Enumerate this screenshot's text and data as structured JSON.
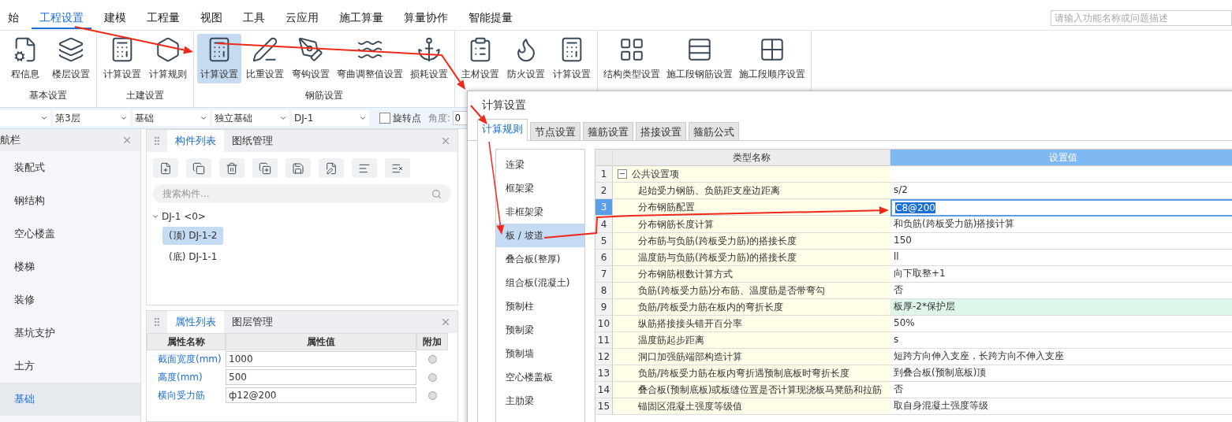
{
  "menu_tabs": [
    {
      "label": "始",
      "selected": false
    },
    {
      "label": "工程设置",
      "selected": true
    },
    {
      "label": "建模",
      "selected": false
    },
    {
      "label": "工程量",
      "selected": false
    },
    {
      "label": "视图",
      "selected": false
    },
    {
      "label": "工具",
      "selected": false
    },
    {
      "label": "云应用",
      "selected": false
    },
    {
      "label": "施工算量",
      "selected": false
    },
    {
      "label": "算量协作",
      "selected": false
    },
    {
      "label": "智能提量",
      "selected": false
    }
  ],
  "search": {
    "placeholder": "请输入功能名称或问题描述"
  },
  "ribbon_groups": [
    {
      "label": "基本设置",
      "buttons": [
        {
          "label": "程信息",
          "selected": false
        },
        {
          "label": "楼层设置",
          "selected": false
        }
      ]
    },
    {
      "label": "土建设置",
      "buttons": [
        {
          "label": "计算设置",
          "selected": false
        },
        {
          "label": "计算规则",
          "selected": false
        }
      ]
    },
    {
      "label": "钢筋设置",
      "buttons": [
        {
          "label": "计算设置",
          "selected": true
        },
        {
          "label": "比重设置",
          "selected": false
        },
        {
          "label": "弯钩设置",
          "selected": false
        },
        {
          "label": "弯曲调整值设置",
          "selected": false
        },
        {
          "label": "损耗设置",
          "selected": false
        }
      ]
    },
    {
      "buttons": [
        {
          "label": "主材设置",
          "selected": false
        },
        {
          "label": "防火设置",
          "selected": false
        },
        {
          "label": "计算设置",
          "selected": false
        }
      ]
    },
    {
      "buttons": [
        {
          "label": "结构类型设置",
          "selected": false
        },
        {
          "label": "施工段钢筋设置",
          "selected": false
        },
        {
          "label": "施工段顺序设置",
          "selected": false
        }
      ]
    }
  ],
  "toolbar": {
    "selects": [
      {
        "value": "第3层"
      },
      {
        "value": "基础"
      },
      {
        "value": "独立基础"
      },
      {
        "value": "DJ-1"
      }
    ],
    "checkbox": {
      "label": "旋转点",
      "checked": false
    },
    "angle": {
      "label": "角度:",
      "value": "0"
    }
  },
  "nav": {
    "title": "航栏",
    "items": [
      {
        "label": "装配式",
        "selected": false
      },
      {
        "label": "钢结构",
        "selected": false
      },
      {
        "label": "空心楼盖",
        "selected": false
      },
      {
        "label": "楼梯",
        "selected": false
      },
      {
        "label": "装修",
        "selected": false
      },
      {
        "label": "基坑支护",
        "selected": false
      },
      {
        "label": "土方",
        "selected": false
      },
      {
        "label": "基础",
        "selected": true
      }
    ]
  },
  "component_panel": {
    "tabs": [
      {
        "label": "构件列表",
        "selected": true
      },
      {
        "label": "图纸管理",
        "selected": false
      }
    ],
    "search_placeholder": "搜索构件...",
    "tree": [
      {
        "label": "DJ-1  <0>",
        "expanded": true,
        "children": [
          {
            "label": "(顶)  DJ-1-2",
            "selected": true
          },
          {
            "label": "(底)  DJ-1-1",
            "selected": false
          }
        ]
      }
    ]
  },
  "property_panel": {
    "tabs": [
      {
        "label": "属性列表",
        "selected": true
      },
      {
        "label": "图层管理",
        "selected": false
      }
    ],
    "columns": [
      "属性名称",
      "属性值",
      "附加"
    ],
    "rows": [
      {
        "name": "截面宽度(mm)",
        "value": "1000",
        "attached": false
      },
      {
        "name": "高度(mm)",
        "value": "500",
        "attached": false
      },
      {
        "name": "横向受力筋",
        "value": "ф12@200",
        "attached": false
      }
    ]
  },
  "dialog": {
    "title": "计算设置",
    "tabs": [
      {
        "label": "计算规则",
        "selected": true
      },
      {
        "label": "节点设置",
        "selected": false
      },
      {
        "label": "箍筋设置",
        "selected": false
      },
      {
        "label": "搭接设置",
        "selected": false
      },
      {
        "label": "箍筋公式",
        "selected": false
      }
    ],
    "categories": [
      {
        "label": "连梁",
        "selected": false
      },
      {
        "label": "框架梁",
        "selected": false
      },
      {
        "label": "非框架梁",
        "selected": false
      },
      {
        "label": "板 / 坡道",
        "selected": true
      },
      {
        "label": "叠合板(整厚)",
        "selected": false
      },
      {
        "label": "组合板(混凝土)",
        "selected": false
      },
      {
        "label": "预制柱",
        "selected": false
      },
      {
        "label": "预制梁",
        "selected": false
      },
      {
        "label": "预制墙",
        "selected": false
      },
      {
        "label": "空心楼盖板",
        "selected": false
      },
      {
        "label": "主肋梁",
        "selected": false
      }
    ],
    "columns": [
      "类型名称",
      "设置值"
    ],
    "rows": [
      {
        "num": "1",
        "kind": "group",
        "expanded": true,
        "toggle": "−",
        "name": "公共设置项",
        "selected": false,
        "highlighted": false
      },
      {
        "num": "2",
        "kind": "item",
        "name": "起始受力钢筋、负筋距支座边距离",
        "value": "s/2",
        "selected": false,
        "highlighted": false
      },
      {
        "num": "3",
        "kind": "item",
        "name": "分布钢筋配置",
        "value": "C8@200",
        "selected": true,
        "highlighted": false
      },
      {
        "num": "4",
        "kind": "item",
        "name": "分布钢筋长度计算",
        "value": "和负筋(跨板受力筋)搭接计算",
        "selected": false,
        "highlighted": false
      },
      {
        "num": "5",
        "kind": "item",
        "name": "分布筋与负筋(跨板受力筋)的搭接长度",
        "value": "150",
        "selected": false,
        "highlighted": false
      },
      {
        "num": "6",
        "kind": "item",
        "name": "温度筋与负筋(跨板受力筋)的搭接长度",
        "value": "ll",
        "selected": false,
        "highlighted": false
      },
      {
        "num": "7",
        "kind": "item",
        "name": "分布钢筋根数计算方式",
        "value": "向下取整+1",
        "selected": false,
        "highlighted": false
      },
      {
        "num": "8",
        "kind": "item",
        "name": "负筋(跨板受力筋)分布筋、温度筋是否带弯勾",
        "value": "否",
        "selected": false,
        "highlighted": false
      },
      {
        "num": "9",
        "kind": "item",
        "name": "负筋/跨板受力筋在板内的弯折长度",
        "value": "板厚-2*保护层",
        "selected": false,
        "highlighted": true
      },
      {
        "num": "10",
        "kind": "item",
        "name": "纵筋搭接接头错开百分率",
        "value": "50%",
        "selected": false,
        "highlighted": false
      },
      {
        "num": "11",
        "kind": "item",
        "name": "温度筋起步距离",
        "value": "s",
        "selected": false,
        "highlighted": false
      },
      {
        "num": "12",
        "kind": "item",
        "name": "洞口加强筋端部构造计算",
        "value": "短跨方向伸入支座，长跨方向不伸入支座",
        "selected": false,
        "highlighted": false
      },
      {
        "num": "13",
        "kind": "item",
        "name": "负筋/跨板受力筋在板内弯折遇预制底板时弯折长度",
        "value": "到叠合板(预制底板)顶",
        "selected": false,
        "highlighted": false
      },
      {
        "num": "14",
        "kind": "item",
        "name": "叠合板(预制底板)或板缝位置是否计算现浇板马凳筋和拉筋",
        "value": "否",
        "selected": false,
        "highlighted": false
      },
      {
        "num": "15",
        "kind": "item",
        "name": "锚固区混凝土强度等级值",
        "value": "取自身混凝土强度等级",
        "selected": false,
        "highlighted": false
      }
    ]
  }
}
